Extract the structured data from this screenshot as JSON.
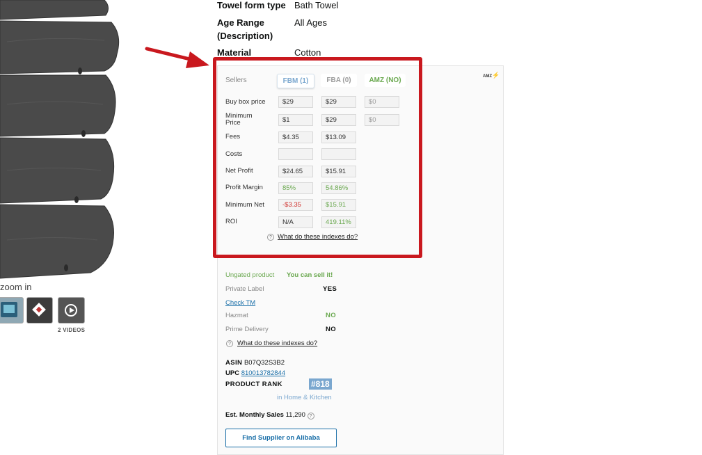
{
  "left_gallery": {
    "zoom_hint": "zoom in",
    "videos_count": "2 VIDEOS"
  },
  "attributes": [
    {
      "label": "Towel form type",
      "value": "Bath Towel"
    },
    {
      "label": "Age Range (Description)",
      "value": "All Ages"
    },
    {
      "label": "Material",
      "value": "Cotton"
    }
  ],
  "extension": {
    "logo_text": "AMZ",
    "sellers_label": "Sellers",
    "tabs": {
      "fbm": "FBM (1)",
      "fba": "FBA (0)",
      "amz": "AMZ (NO)"
    },
    "rows": [
      {
        "label": "Buy box price",
        "fbm": "$29",
        "fba": "$29",
        "amz": "$0"
      },
      {
        "label": "Minimum Price",
        "fbm": "$1",
        "fba": "$29",
        "amz": "$0"
      },
      {
        "label": "Fees",
        "fbm": "$4.35",
        "fba": "$13.09"
      },
      {
        "label": "Costs",
        "fbm": "",
        "fba": ""
      },
      {
        "label": "Net Profit",
        "fbm": "$24.65",
        "fba": "$15.91"
      },
      {
        "label": "Profit Margin",
        "fbm": "85%",
        "fba": "54.86%"
      },
      {
        "label": "Minimum Net",
        "fbm": "-$3.35",
        "fba": "$15.91"
      },
      {
        "label": "ROI",
        "fbm": "N/A",
        "fba": "419.11%"
      }
    ],
    "help_link": "What do these indexes do?",
    "ungated_label": "Ungated product",
    "sell_status": "You can sell it!",
    "private_label": {
      "label": "Private Label",
      "value": "YES"
    },
    "check_tm": "Check TM",
    "hazmat": {
      "label": "Hazmat",
      "value": "NO"
    },
    "prime": {
      "label": "Prime Delivery",
      "value": "NO"
    },
    "help_link_2": "What do these indexes do?",
    "asin_label": "ASIN",
    "asin": "B07Q32S3B2",
    "upc_label": "UPC",
    "upc": "810013782844",
    "rank_label": "PRODUCT RANK",
    "rank": "#818",
    "rank_category": "in Home & Kitchen",
    "sales_label": "Est. Monthly Sales",
    "sales": "11,290",
    "supplier_button": "Find Supplier on Alibaba"
  },
  "colors": {
    "highlight": "#c9181e",
    "positive": "#6aa84f",
    "negative": "#d0312d",
    "accent": "#7aa7cf",
    "link": "#1a6fa8"
  }
}
